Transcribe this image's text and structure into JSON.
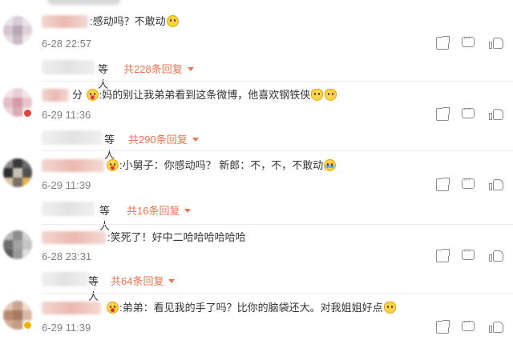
{
  "comments": [
    {
      "text": ":感动吗？不敢动",
      "emojis": [
        "laugh-emoji"
      ],
      "date": "6-28 22:57",
      "reply_who": "等人",
      "reply_count": "共228条回复",
      "badge": "none"
    },
    {
      "name_fragment": "分",
      "text": ":妈的别让我弟弟看到这条微博，他喜欢钢铁侠",
      "emojis": [
        "cat-emoji",
        "cat-emoji"
      ],
      "date": "6-29 11:36",
      "reply_who": "等人",
      "reply_count": "共290条回复",
      "badge": "red"
    },
    {
      "text": ":小舅子：你感动吗？ 新郎：不，不，不敢动",
      "emojis": [
        "cry-laugh-emoji"
      ],
      "date": "6-29 11:39",
      "reply_who": "等人",
      "reply_count": "共16条回复",
      "badge": "none"
    },
    {
      "text": ":笑死了！好中二哈哈哈哈哈哈",
      "emojis": [],
      "date": "6-28 23:31",
      "reply_who": "等人",
      "reply_count": "共64条回复",
      "badge": "none"
    },
    {
      "text": ":弟弟：看见我的手了吗？比你的脑袋还大。对我姐姐好点",
      "emojis": [
        "cat-emoji"
      ],
      "date": "6-29 11:39",
      "reply_who": "",
      "reply_count": "",
      "badge": "yellow"
    }
  ],
  "icons": {
    "share": "share-icon",
    "reply": "comment-icon",
    "like": "thumbs-up-icon"
  },
  "colors": {
    "reply_link": "#eb7350",
    "meta": "#808080",
    "text": "#333333"
  }
}
